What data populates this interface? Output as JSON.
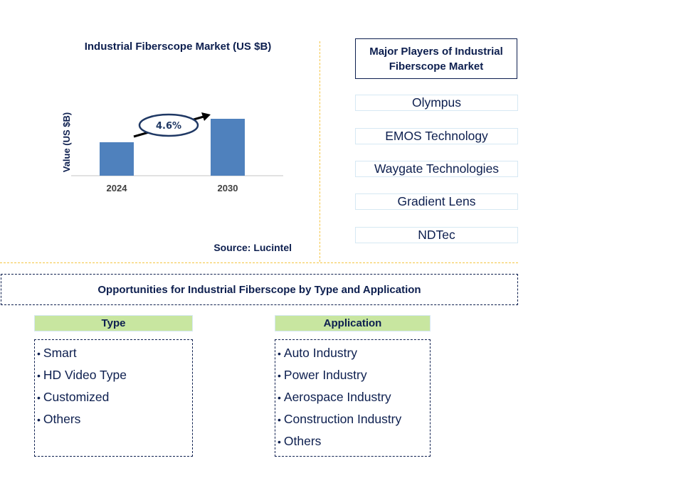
{
  "chart_data": {
    "type": "bar",
    "title": "Industrial Fiberscope Market (US $B)",
    "xlabel": "",
    "ylabel": "Value (US $B)",
    "categories": [
      "2024",
      "2030"
    ],
    "values": [
      1.0,
      1.7
    ],
    "value_note": "relative bar heights; no axis scale printed",
    "annotation": {
      "label": "4.6%",
      "meaning": "CAGR 2024-2030"
    },
    "grid": false,
    "colors": {
      "bar": "#4f81bd",
      "axis": "#d9d9d9",
      "annotation_border": "#1f3864"
    }
  },
  "source": "Source: Lucintel",
  "players": {
    "title": "Major Players of Industrial Fiberscope Market",
    "items": [
      "Olympus",
      "EMOS Technology",
      "Waygate Technologies",
      "Gradient Lens",
      "NDTec"
    ]
  },
  "opportunities": {
    "title": "Opportunities for Industrial Fiberscope by Type and Application",
    "type": {
      "header": "Type",
      "items": [
        "Smart",
        "HD Video Type",
        "Customized",
        "Others"
      ]
    },
    "application": {
      "header": "Application",
      "items": [
        "Auto Industry",
        "Power Industry",
        "Aerospace Industry",
        "Construction Industry",
        "Others"
      ]
    }
  },
  "bullet": "•",
  "colors": {
    "text": "#0d1f4f",
    "divider": "#f5c542",
    "header_bg": "#c8e6a0"
  }
}
